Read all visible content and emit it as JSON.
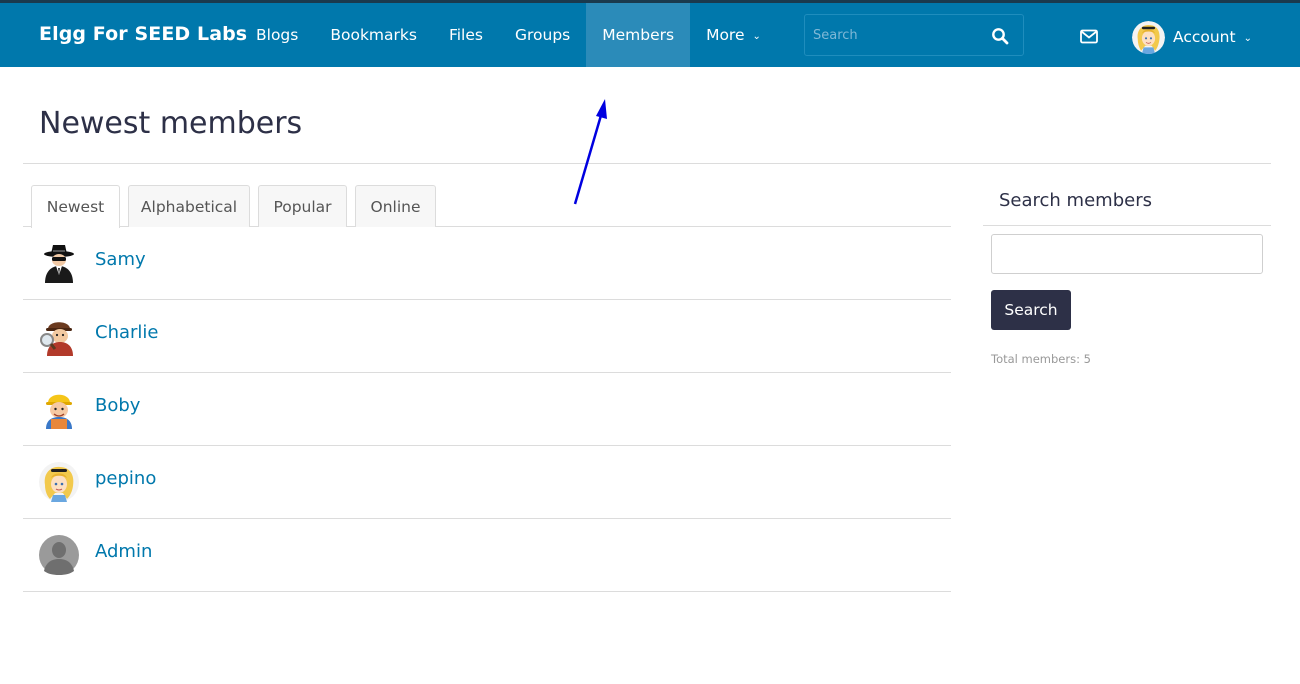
{
  "header": {
    "brand": "Elgg For SEED Labs",
    "nav": [
      "Blogs",
      "Bookmarks",
      "Files",
      "Groups",
      "Members",
      "More"
    ],
    "active_nav": "Members",
    "search_placeholder": "Search",
    "account_label": "Account",
    "icons": [
      "search-icon",
      "mail-icon",
      "chevron-down-icon"
    ]
  },
  "page": {
    "title": "Newest members"
  },
  "tabs": [
    "Newest",
    "Alphabetical",
    "Popular",
    "Online"
  ],
  "active_tab": "Newest",
  "members": [
    {
      "name": "Samy",
      "avatar": "spy"
    },
    {
      "name": "Charlie",
      "avatar": "detective"
    },
    {
      "name": "Boby",
      "avatar": "builder"
    },
    {
      "name": "pepino",
      "avatar": "blonde-girl"
    },
    {
      "name": "Admin",
      "avatar": "default-silhouette"
    }
  ],
  "sidebar": {
    "title": "Search members",
    "input_value": "",
    "button_label": "Search",
    "total_label": "Total members: 5"
  },
  "colors": {
    "topbar": "#0078ac",
    "topbar_active": "#2b8bb9",
    "link": "#0078ac",
    "button": "#2d3047",
    "annotation_arrow": "#0000e0"
  }
}
